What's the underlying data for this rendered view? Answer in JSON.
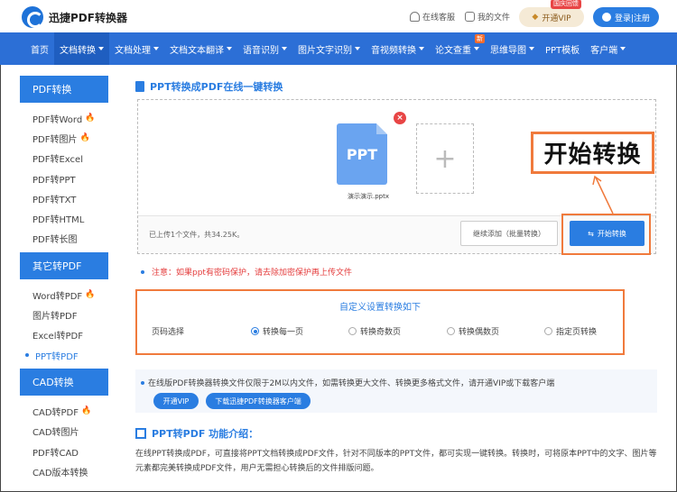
{
  "header": {
    "brand": "迅捷PDF转换器",
    "service_label": "在线客服",
    "files_label": "我的文件",
    "vip_label": "开通VIP",
    "vip_badge": "国庆回馈",
    "login_label": "登录|注册"
  },
  "nav": {
    "items": [
      {
        "label": "首页",
        "caret": false
      },
      {
        "label": "文档转换",
        "caret": true
      },
      {
        "label": "文档处理",
        "caret": true
      },
      {
        "label": "文档文本翻译",
        "caret": true
      },
      {
        "label": "语音识别",
        "caret": true
      },
      {
        "label": "图片文字识别",
        "caret": true
      },
      {
        "label": "音视频转换",
        "caret": true
      },
      {
        "label": "论文查重",
        "caret": true
      },
      {
        "label": "思维导图",
        "caret": true
      },
      {
        "label": "PPT模板",
        "caret": false
      },
      {
        "label": "客户端",
        "caret": true
      }
    ],
    "new_badge": "新"
  },
  "sidebar": {
    "sections": [
      {
        "title": "PDF转换",
        "items": [
          "PDF转Word",
          "PDF转图片",
          "PDF转Excel",
          "PDF转PPT",
          "PDF转TXT",
          "PDF转HTML",
          "PDF转长图"
        ]
      },
      {
        "title": "其它转PDF",
        "items": [
          "Word转PDF",
          "图片转PDF",
          "Excel转PDF",
          "PPT转PDF"
        ]
      },
      {
        "title": "CAD转换",
        "items": [
          "CAD转PDF",
          "CAD转图片",
          "PDF转CAD",
          "CAD版本转换"
        ]
      }
    ]
  },
  "main": {
    "title": "PPT转换成PDF在线一键转换",
    "file_type": "PPT",
    "file_name": "演示演示.pptx",
    "upload_info": "已上传1个文件，共34.25K。",
    "add_more_label": "继续添加（批量转换）",
    "convert_label": "开始转换",
    "callout_text": "开始转换",
    "notice": "注意：如果ppt有密码保护，请去除加密保护再上传文件",
    "settings_title": "自定义设置转换如下",
    "settings_label": "页码选择",
    "radio_options": [
      "转换每一页",
      "转换奇数页",
      "转换偶数页",
      "指定页转换"
    ],
    "radio_selected": 0,
    "info_text": "在线版PDF转换器转换文件仅限于2M以内文件，如需转换更大文件、转换更多格式文件，请开通VIP或下载客户端",
    "info_btn_vip": "开通VIP",
    "info_btn_download": "下载迅捷PDF转换器客户端",
    "intro_title": "PPT转PDF 功能介绍：",
    "intro_text": "在线PPT转换成PDF，可直接将PPT文档转换成PDF文件，针对不同版本的PPT文件，都可实现一键转换。转换时，可将原本PPT中的文字、图片等元素都完美转换成PDF文件，用户无需担心转换后的文件排版问题。"
  },
  "colors": {
    "primary": "#2a7de1",
    "nav": "#2c6fd6",
    "accent_orange": "#f07a3c",
    "warning_red": "#e43c3c"
  }
}
